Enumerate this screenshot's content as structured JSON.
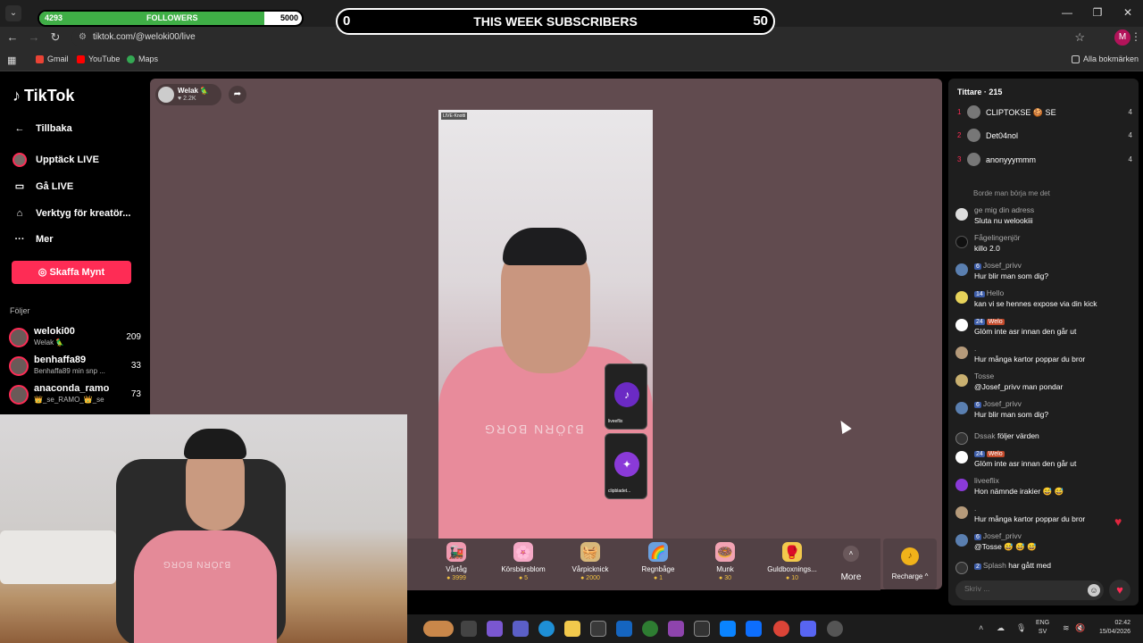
{
  "browser": {
    "url": "tiktok.com/@weloki00/live",
    "bookmarks": [
      {
        "label": "Gmail",
        "color": "#ea4335"
      },
      {
        "label": "YouTube",
        "color": "#ff0000"
      },
      {
        "label": "Maps",
        "color": "#34a853"
      }
    ],
    "all_bookmarks": "Alla bokmärken",
    "profile_initial": "M"
  },
  "overlays": {
    "followers": {
      "current": "4293",
      "label": "FOLLOWERS",
      "goal": "5000",
      "progress": 0.8586
    },
    "subscribers": {
      "left": "0",
      "title": "THIS WEEK SUBSCRIBERS",
      "right": "50"
    }
  },
  "sidebar": {
    "logo": "TikTok",
    "items": [
      {
        "label": "Tillbaka",
        "icon": "arrow-left-icon"
      },
      {
        "label": "Upptäck LIVE",
        "icon": "live-avatar-icon"
      },
      {
        "label": "Gå LIVE",
        "icon": "video-camera-icon"
      },
      {
        "label": "Verktyg för kreatör...",
        "icon": "creator-tools-icon"
      },
      {
        "label": "Mer",
        "icon": "more-dots-icon"
      }
    ],
    "coins_button": "Skaffa Mynt",
    "following_title": "Följer",
    "following": [
      {
        "name": "weloki00",
        "sub": "Welak 🦜",
        "count": "209"
      },
      {
        "name": "benhaffa89",
        "sub": "Benhaffa89 min snp ...",
        "count": "33"
      },
      {
        "name": "anaconda_ramo",
        "sub": "👑_se_RAMO_👑_se",
        "count": "73"
      }
    ]
  },
  "stream": {
    "host_name": "Welak 🦜",
    "host_likes": "♥ 2.2K",
    "video_label": "LIVE·Knotti",
    "shirt_text": "BJÖRN BORG",
    "mini_cards": [
      {
        "label": "liveeflix"
      },
      {
        "label": "clipbladet..."
      }
    ]
  },
  "gifts": [
    {
      "name": "Vårtåg",
      "price": "3999",
      "icon": "🚂",
      "color": "#f09ab0"
    },
    {
      "name": "Körsbärsblom",
      "price": "5",
      "icon": "🌸",
      "color": "#f5a9c6"
    },
    {
      "name": "Vårpicknick",
      "price": "2000",
      "icon": "🧺",
      "color": "#d8b87a"
    },
    {
      "name": "Regnbåge",
      "price": "1",
      "icon": "🌈",
      "color": "#6aa0e0"
    },
    {
      "name": "Munk",
      "price": "30",
      "icon": "🍩",
      "color": "#f2a3b3"
    },
    {
      "name": "Guldboxnings...",
      "price": "10",
      "icon": "🥊",
      "color": "#f2c94c"
    }
  ],
  "more_label": "More",
  "recharge_label": "Recharge ^",
  "viewers": {
    "title": "Tittare · 215",
    "top": [
      {
        "rank": "1",
        "name": "CLIPTOKSE 🍪 SE",
        "score": "4"
      },
      {
        "rank": "2",
        "name": "Det04nol",
        "score": "4"
      },
      {
        "rank": "3",
        "name": "anonyyymmm",
        "score": "4"
      }
    ]
  },
  "chat": {
    "partial": "Borde man börja me det",
    "messages": [
      {
        "user": "ge mig din adress",
        "text": "Sluta nu welookiii",
        "badges": []
      },
      {
        "user": "Fågelingenjör",
        "text": "killo 2.0",
        "badges": []
      },
      {
        "user": "Josef_privv",
        "text": "Hur blir man som dig?",
        "badges": [
          "6"
        ]
      },
      {
        "user": "Hello",
        "text": "kan vi se hennes expose via din kick",
        "badges": [
          "14"
        ]
      },
      {
        "user": "",
        "text": "Glöm inte asr innan den går ut",
        "badges": [
          "24",
          "Welo"
        ]
      },
      {
        "user": ".",
        "text": "Hur många kartor poppar du bror",
        "badges": []
      },
      {
        "user": "Tosse",
        "text": "@Josef_privv man pondar",
        "badges": []
      },
      {
        "user": "Josef_privv",
        "text": "Hur blir man som dig?",
        "badges": [
          "6"
        ]
      },
      {
        "user": "Dssak",
        "text": "följer värden",
        "badges": []
      },
      {
        "user": "",
        "text": "Glöm inte asr innan den går ut",
        "badges": [
          "24",
          "Welo"
        ]
      },
      {
        "user": "liveeflix",
        "text": "Hon nämnde irakier 😅 😅",
        "badges": []
      },
      {
        "user": ".",
        "text": "Hur många kartor poppar du bror",
        "badges": []
      },
      {
        "user": "Josef_privv",
        "text": "@Tosse 😅 😅 😅",
        "badges": [
          "6"
        ]
      },
      {
        "user": "Splash",
        "text": "har gått med",
        "badges": [
          "2"
        ]
      }
    ],
    "input_placeholder": "Skriv ..."
  },
  "tray": {
    "lang_top": "ENG",
    "lang_bottom": "SV",
    "time": "02:42",
    "date": "15/04/2026"
  }
}
